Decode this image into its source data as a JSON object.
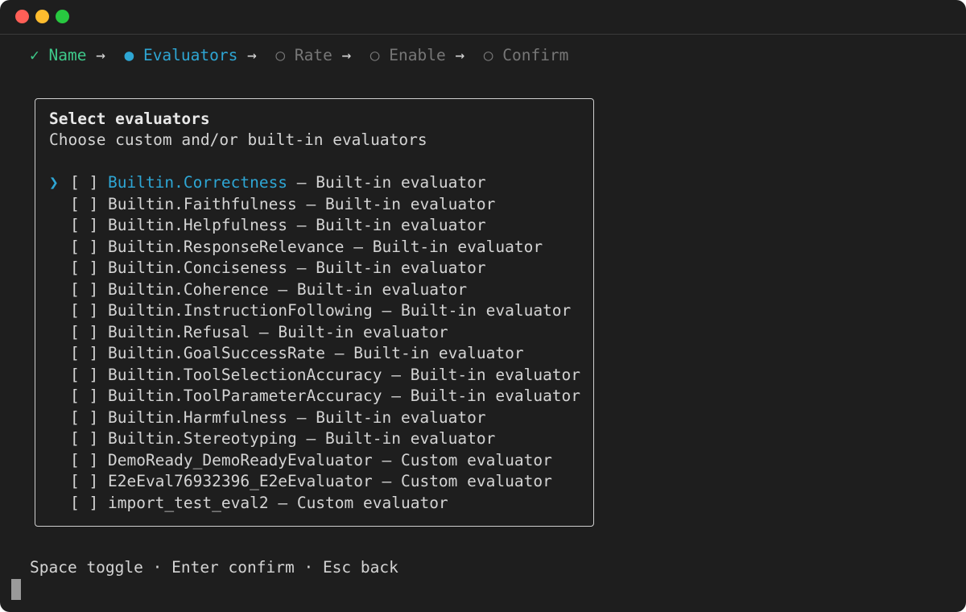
{
  "wizard": {
    "steps": [
      {
        "marker": "✓",
        "label": "Name",
        "state": "done"
      },
      {
        "marker": "●",
        "label": "Evaluators",
        "state": "current"
      },
      {
        "marker": "○",
        "label": "Rate",
        "state": "pending"
      },
      {
        "marker": "○",
        "label": "Enable",
        "state": "pending"
      },
      {
        "marker": "○",
        "label": "Confirm",
        "state": "pending"
      }
    ],
    "separator": "→"
  },
  "panel": {
    "title": "Select evaluators",
    "subtitle": "Choose custom and/or built-in evaluators",
    "cursor_glyph": "❯",
    "checkbox": "[ ]",
    "dash": "–",
    "items": [
      {
        "name": "Builtin.Correctness",
        "desc": "Built-in evaluator"
      },
      {
        "name": "Builtin.Faithfulness",
        "desc": "Built-in evaluator"
      },
      {
        "name": "Builtin.Helpfulness",
        "desc": "Built-in evaluator"
      },
      {
        "name": "Builtin.ResponseRelevance",
        "desc": "Built-in evaluator"
      },
      {
        "name": "Builtin.Conciseness",
        "desc": "Built-in evaluator"
      },
      {
        "name": "Builtin.Coherence",
        "desc": "Built-in evaluator"
      },
      {
        "name": "Builtin.InstructionFollowing",
        "desc": "Built-in evaluator"
      },
      {
        "name": "Builtin.Refusal",
        "desc": "Built-in evaluator"
      },
      {
        "name": "Builtin.GoalSuccessRate",
        "desc": "Built-in evaluator"
      },
      {
        "name": "Builtin.ToolSelectionAccuracy",
        "desc": "Built-in evaluator"
      },
      {
        "name": "Builtin.ToolParameterAccuracy",
        "desc": "Built-in evaluator"
      },
      {
        "name": "Builtin.Harmfulness",
        "desc": "Built-in evaluator"
      },
      {
        "name": "Builtin.Stereotyping",
        "desc": "Built-in evaluator"
      },
      {
        "name": "DemoReady_DemoReadyEvaluator",
        "desc": "Custom evaluator"
      },
      {
        "name": "E2eEval76932396_E2eEvaluator",
        "desc": "Custom evaluator"
      },
      {
        "name": "import_test_eval2",
        "desc": "Custom evaluator"
      }
    ]
  },
  "footer": {
    "hint": "Space toggle · Enter confirm · Esc back"
  },
  "colors": {
    "done": "#3ec98a",
    "current": "#2ea6d4",
    "pending": "#777777"
  }
}
